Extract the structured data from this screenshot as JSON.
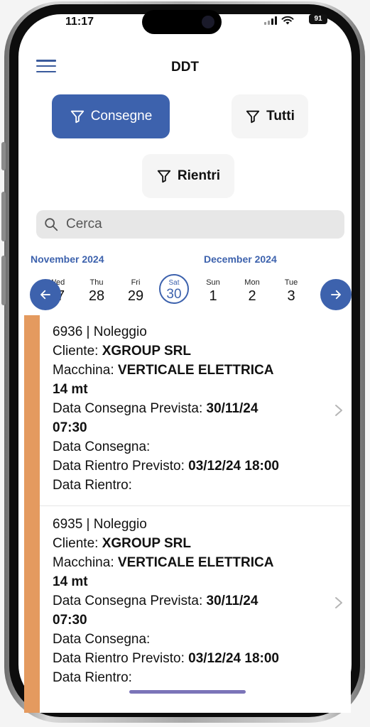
{
  "status_bar": {
    "time": "11:17",
    "battery": "91"
  },
  "header": {
    "title": "DDT"
  },
  "filters": {
    "consegne": "Consegne",
    "tutti": "Tutti",
    "rientri": "Rientri"
  },
  "search": {
    "placeholder": "Cerca",
    "value": ""
  },
  "calendar": {
    "month_left": "November 2024",
    "month_right": "December 2024",
    "days": [
      {
        "name": "Wed",
        "num": "27"
      },
      {
        "name": "Thu",
        "num": "28"
      },
      {
        "name": "Fri",
        "num": "29"
      },
      {
        "name": "Sat",
        "num": "30"
      },
      {
        "name": "Sun",
        "num": "1"
      },
      {
        "name": "Mon",
        "num": "2"
      },
      {
        "name": "Tue",
        "num": "3"
      }
    ]
  },
  "cards": [
    {
      "header": "6936 | Noleggio",
      "cliente_label": "Cliente:",
      "cliente": "XGROUP SRL",
      "macchina_label": "Macchina:",
      "macchina": "VERTICALE ELETTRICA",
      "macchina_cont": "14 mt",
      "consegna_prevista_label": "Data Consegna Prevista:",
      "consegna_prevista": "30/11/24",
      "consegna_prevista_time": "07:30",
      "consegna_label": "Data Consegna:",
      "rientro_previsto_label": "Data Rientro Previsto:",
      "rientro_previsto": "03/12/24 18:00",
      "rientro_label": "Data Rientro:"
    },
    {
      "header": "6935 | Noleggio",
      "cliente_label": "Cliente:",
      "cliente": "XGROUP SRL",
      "macchina_label": "Macchina:",
      "macchina": "VERTICALE ELETTRICA",
      "macchina_cont": "14 mt",
      "consegna_prevista_label": "Data Consegna Prevista:",
      "consegna_prevista": "30/11/24",
      "consegna_prevista_time": "07:30",
      "consegna_label": "Data Consegna:",
      "rientro_previsto_label": "Data Rientro Previsto:",
      "rientro_previsto": "03/12/24 18:00",
      "rientro_label": "Data Rientro:"
    }
  ],
  "colors": {
    "accent": "#3d62ad",
    "card_bar": "#e49a5f"
  }
}
